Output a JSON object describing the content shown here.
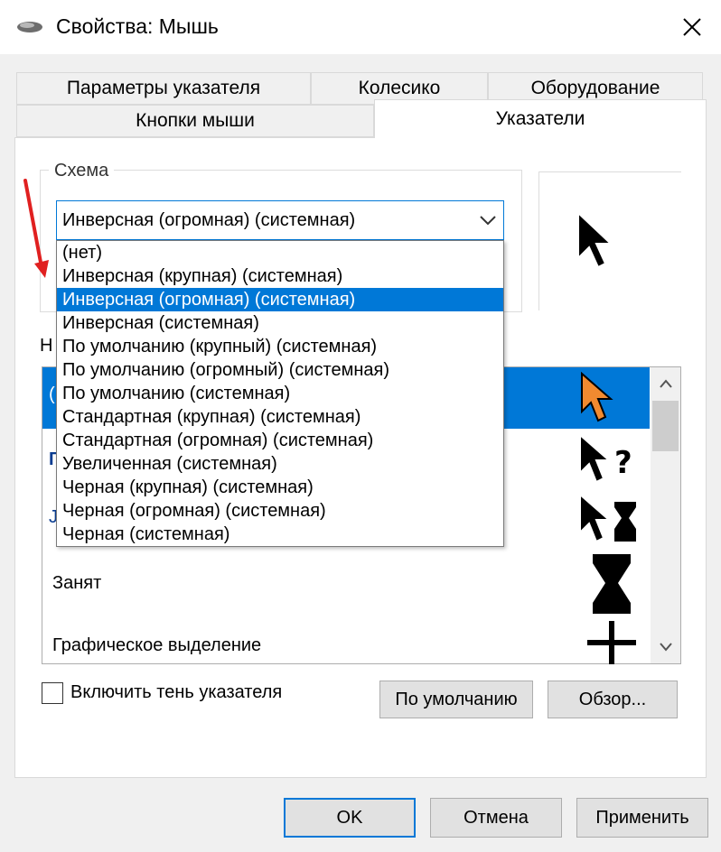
{
  "window": {
    "title": "Свойства: Мышь",
    "icon": "mouse-icon",
    "close": "close-icon"
  },
  "tabs": {
    "row1": [
      "Параметры указателя",
      "Колесико",
      "Оборудование"
    ],
    "row2": [
      "Кнопки мыши",
      "Указатели"
    ],
    "active": "Указатели"
  },
  "scheme": {
    "group_label": "Схема",
    "selected": "Инверсная (огромная) (системная)",
    "options": [
      "(нет)",
      "Инверсная (крупная) (системная)",
      "Инверсная (огромная) (системная)",
      "Инверсная (системная)",
      "По умолчанию (крупный) (системная)",
      "По умолчанию (огромный) (системная)",
      "По умолчанию (системная)",
      "Стандартная (крупная) (системная)",
      "Стандартная (огромная) (системная)",
      "Увеличенная (системная)",
      "Черная (крупная) (системная)",
      "Черная (огромная) (системная)",
      "Черная (системная)"
    ],
    "highlighted_index": 2
  },
  "customize": {
    "label_fragment": "Н",
    "fragments": [
      "(",
      "Г",
      "Ј"
    ],
    "visible_rows": [
      "Занят",
      "Графическое выделение"
    ],
    "cursor_icons": [
      "arrow-orange-icon",
      "help-select-icon",
      "working-icon",
      "busy-icon",
      "crosshair-icon"
    ]
  },
  "shadow": {
    "label": "Включить тень указателя",
    "checked": false
  },
  "buttons": {
    "default": "По умолчанию",
    "browse": "Обзор...",
    "ok": "OK",
    "cancel": "Отмена",
    "apply": "Применить"
  },
  "colors": {
    "accent": "#0078d7",
    "annotation": "#e02020",
    "cursor_orange": "#f08a30"
  }
}
